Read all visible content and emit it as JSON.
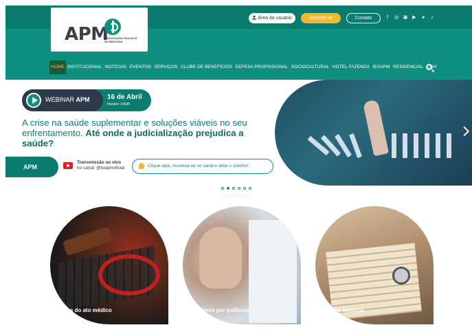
{
  "header": {
    "logo_text": "APM",
    "logo_subtitle": "ASSOCIAÇÃO PAULISTA DE MEDICINA",
    "buttons": {
      "area_usuario": "Área do usuário",
      "associe": "Associe-se",
      "contato": "Contato"
    },
    "social_icons": [
      "facebook-icon",
      "instagram-icon",
      "linkedin-icon",
      "youtube-icon",
      "spotify-icon",
      "tiktok-icon"
    ],
    "nav": [
      "HOME",
      "INSTITUCIONAL",
      "NOTÍCIAS",
      "EVENTOS",
      "SERVIÇOS",
      "CLUBE DE BENEFÍCIOS",
      "DEFESA PROFISSIONAL",
      "SOCIOCULTURAL",
      "HOTEL FAZENDA",
      "IESAPM",
      "RESIDENCIAL",
      "CQH"
    ],
    "active_nav": "HOME"
  },
  "banner": {
    "webinar_label_normal": "WEBINAR ",
    "webinar_label_bold": "APM",
    "date": "16 de Abril",
    "hour": "Horário: 19h30",
    "headline_normal": "A crise na saúde suplementar e soluções viáveis no seu enfrentamento. ",
    "headline_bold": "Até onde a judicialização prejudica a saúde?",
    "apm_tag": "APM",
    "yt_title": "Transmissão ao vivo",
    "yt_channel": "no canal: @tvapmoficial",
    "bell_text": "Clique aqui, inscreva-se no canal e ative o sininho!",
    "slides_total": 6,
    "slide_active": 2
  },
  "cards": [
    {
      "label": "Defesa do ato médico"
    },
    {
      "label": "Filmagens por políticos"
    },
    {
      "label": "Escolas médicas"
    }
  ],
  "colors": {
    "primary": "#0e8f7f",
    "primary_dark": "#0a7d6e",
    "accent": "#f5b82e"
  }
}
